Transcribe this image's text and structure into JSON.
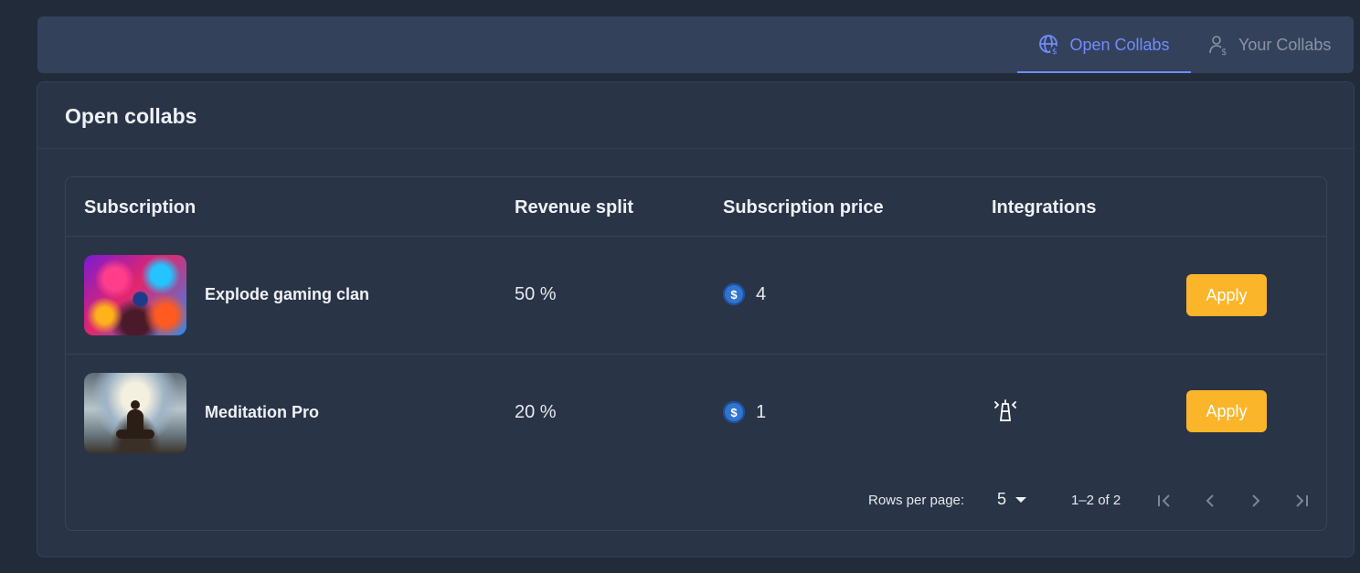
{
  "tabs": [
    {
      "label": "Open Collabs",
      "icon": "globe-dollar-icon",
      "active": true
    },
    {
      "label": "Your Collabs",
      "icon": "user-dollar-icon",
      "active": false
    }
  ],
  "card": {
    "title": "Open collabs"
  },
  "table": {
    "headers": [
      "Subscription",
      "Revenue split",
      "Subscription price",
      "Integrations"
    ],
    "rows": [
      {
        "name": "Explode gaming clan",
        "revenue_split": "50 %",
        "price": "4",
        "integration": "",
        "apply_label": "Apply"
      },
      {
        "name": "Meditation Pro",
        "revenue_split": "20 %",
        "price": "1",
        "integration": "lighthouse-icon",
        "apply_label": "Apply"
      }
    ]
  },
  "pagination": {
    "rows_per_page_label": "Rows per page:",
    "rows_per_page_value": "5",
    "range": "1–2 of 2"
  },
  "colors": {
    "accent": "#6f8cff",
    "apply_button": "#fbb52a",
    "coin": "#2f74d0"
  }
}
